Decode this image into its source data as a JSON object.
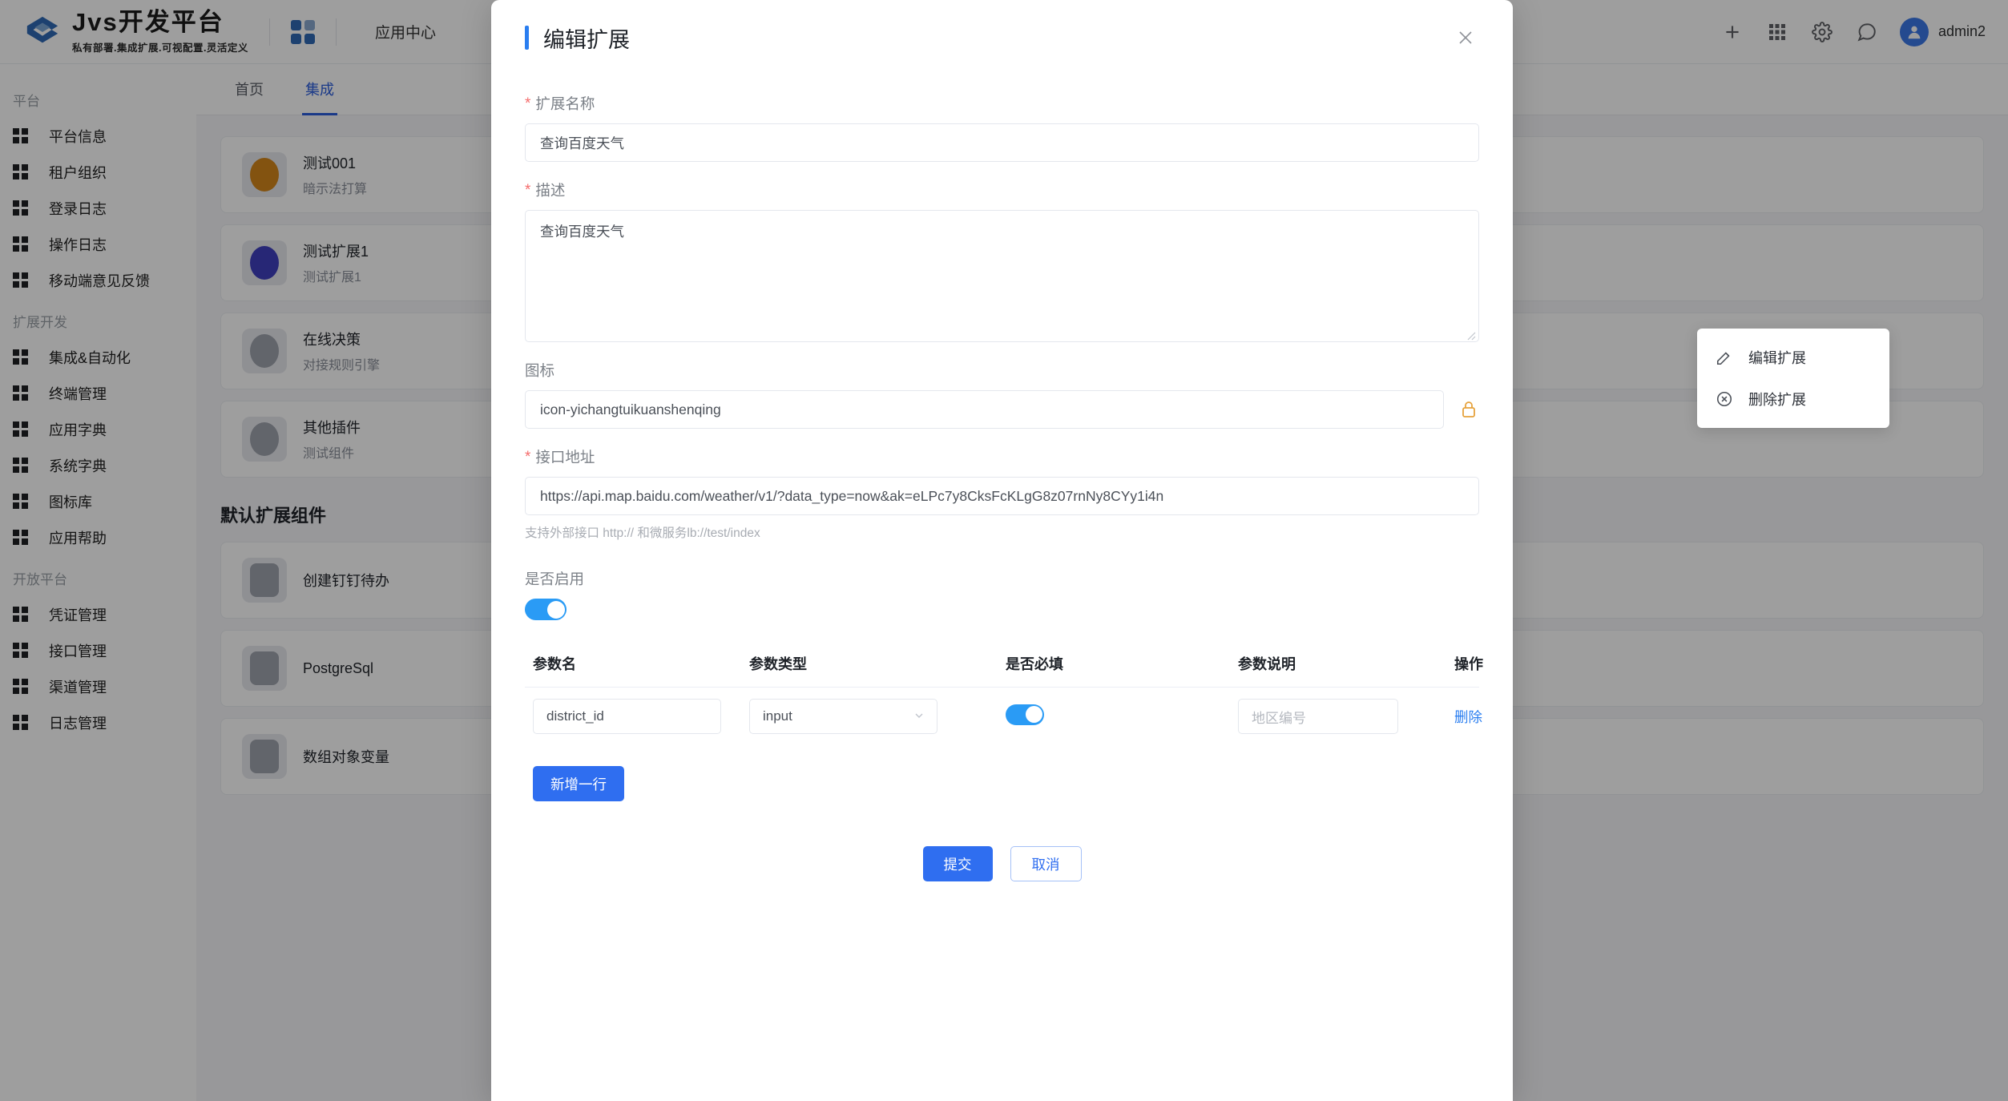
{
  "brand": {
    "title": "Jvs开发平台",
    "subtitle": "私有部署.集成扩展.可视配置.灵活定义"
  },
  "topbar": {
    "apps_icon": "apps-grid-icon",
    "nav_label": "应用中心",
    "add_icon": "plus-icon",
    "grid_icon": "grid-menu-icon",
    "settings_icon": "gear-icon",
    "message_icon": "chat-icon",
    "user_icon": "user-avatar-icon",
    "username": "admin2"
  },
  "tabs": [
    {
      "label": "首页",
      "active": false
    },
    {
      "label": "集成",
      "active": true
    }
  ],
  "sidebar": {
    "groups": [
      {
        "title": "平台",
        "items": [
          {
            "label": "平台信息"
          },
          {
            "label": "租户组织"
          },
          {
            "label": "登录日志"
          },
          {
            "label": "操作日志"
          },
          {
            "label": "移动端意见反馈"
          }
        ]
      },
      {
        "title": "扩展开发",
        "items": [
          {
            "label": "集成&自动化"
          },
          {
            "label": "终端管理"
          },
          {
            "label": "应用字典"
          },
          {
            "label": "系统字典"
          },
          {
            "label": "图标库"
          },
          {
            "label": "应用帮助"
          }
        ]
      },
      {
        "title": "开放平台",
        "items": [
          {
            "label": "凭证管理"
          },
          {
            "label": "接口管理"
          },
          {
            "label": "渠道管理"
          },
          {
            "label": "日志管理"
          }
        ]
      }
    ]
  },
  "background_list": {
    "cards": [
      {
        "title": "测试001",
        "subtitle": "暗示法打算",
        "icon_color": "#d4871b"
      },
      {
        "title": "测试扩展1",
        "subtitle": "测试扩展1",
        "icon_color": "#3f3fbf"
      },
      {
        "title": "在线决策",
        "subtitle": "对接规则引擎",
        "icon_color": "#9fa3ad"
      },
      {
        "title": "其他插件",
        "subtitle": "测试组件",
        "icon_color": "#9fa3ad"
      }
    ],
    "section_title": "默认扩展组件",
    "default_cards": [
      {
        "title": "创建钉钉待办",
        "subtitle": "",
        "icon_color": "#9fa3ad"
      },
      {
        "title": "PostgreSql",
        "subtitle": "",
        "icon_color": "#9fa3ad"
      },
      {
        "title": "数组对象变量",
        "subtitle": "",
        "icon_color": "#9fa3ad"
      }
    ]
  },
  "context_menu": {
    "items": [
      {
        "label": "编辑扩展",
        "icon": "edit-pencil-icon"
      },
      {
        "label": "删除扩展",
        "icon": "delete-circle-icon"
      }
    ]
  },
  "modal": {
    "title": "编辑扩展",
    "close_icon": "close-icon",
    "fields": {
      "name": {
        "label": "扩展名称",
        "required": true,
        "value": "查询百度天气"
      },
      "description": {
        "label": "描述",
        "required": true,
        "value": "查询百度天气"
      },
      "icon": {
        "label": "图标",
        "required": false,
        "value": "icon-yichangtuikuanshenqing",
        "picker_icon": "icon-picker-icon"
      },
      "api_url": {
        "label": "接口地址",
        "required": true,
        "value": "https://api.map.baidu.com/weather/v1/?data_type=now&ak=eLPc7y8CksFcKLgG8z07rnNy8CYy1i4n",
        "hint": "支持外部接口 http:// 和微服务lb://test/index"
      },
      "enabled": {
        "label": "是否启用",
        "value": true
      }
    },
    "params_table": {
      "headers": [
        "参数名",
        "参数类型",
        "是否必填",
        "参数说明",
        "操作"
      ],
      "rows": [
        {
          "name": "district_id",
          "type": "input",
          "required": true,
          "description_placeholder": "地区编号",
          "action_label": "删除"
        }
      ]
    },
    "add_row_label": "新增一行",
    "submit_label": "提交",
    "cancel_label": "取消"
  },
  "colors": {
    "accent": "#2f6ef0",
    "switch_on": "#2a9bf5",
    "required_star": "#f56c6c",
    "link": "#2a7ef0"
  }
}
